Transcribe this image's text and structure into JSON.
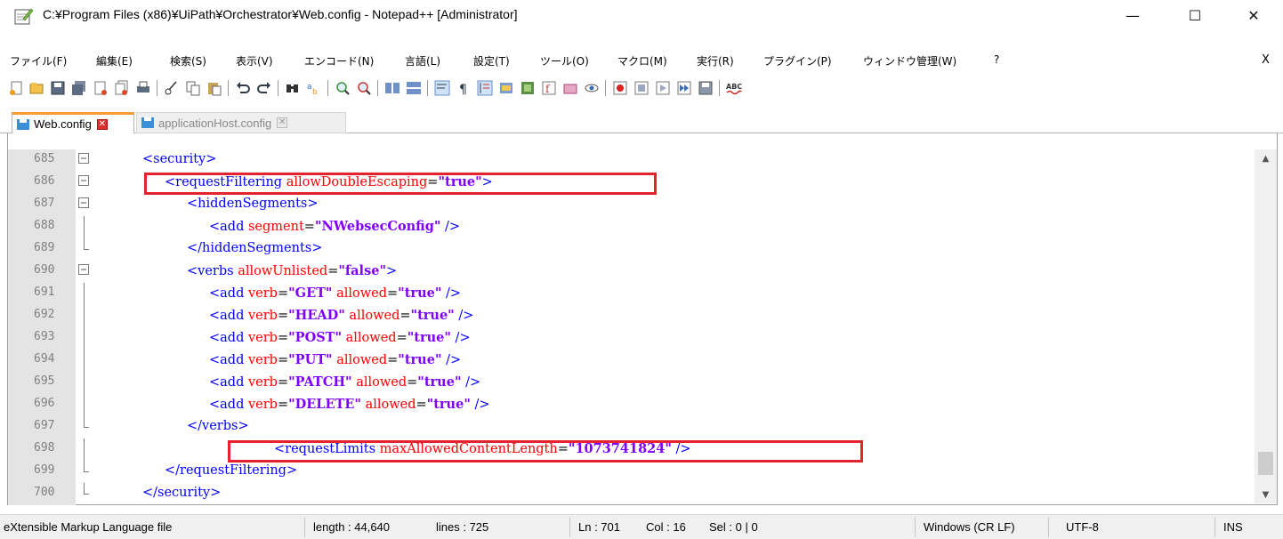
{
  "window": {
    "title": "C:¥Program Files (x86)¥UiPath¥Orchestrator¥Web.config - Notepad++ [Administrator]",
    "minimize_glyph": "—",
    "maximize_glyph": "☐",
    "close_glyph": "✕"
  },
  "menu": {
    "items": [
      "ファイル(F)",
      "編集(E)",
      "検索(S)",
      "表示(V)",
      "エンコード(N)",
      "言語(L)",
      "設定(T)",
      "ツール(O)",
      "マクロ(M)",
      "実行(R)",
      "プラグイン(P)",
      "ウィンドウ管理(W)",
      "?"
    ],
    "close_label": "X"
  },
  "tabs": [
    {
      "label": "Web.config",
      "active": true
    },
    {
      "label": "applicationHost.config",
      "active": false
    }
  ],
  "editor": {
    "lines": [
      {
        "num": "685",
        "parts": [
          [
            "tag",
            "<security>"
          ]
        ]
      },
      {
        "num": "686",
        "parts": [
          [
            "tag",
            "<requestFiltering "
          ],
          [
            "attr",
            "allowDoubleEscaping"
          ],
          [
            "eq",
            "="
          ],
          [
            "val",
            "\"true\""
          ],
          [
            "tag",
            ">"
          ]
        ]
      },
      {
        "num": "687",
        "parts": [
          [
            "tag",
            "<hiddenSegments>"
          ]
        ]
      },
      {
        "num": "688",
        "parts": [
          [
            "tag",
            "<add "
          ],
          [
            "attr",
            "segment"
          ],
          [
            "eq",
            "="
          ],
          [
            "val",
            "\"NWebsecConfig\""
          ],
          [
            "tag",
            " />"
          ]
        ]
      },
      {
        "num": "689",
        "parts": [
          [
            "tag",
            "</hiddenSegments>"
          ]
        ]
      },
      {
        "num": "690",
        "parts": [
          [
            "tag",
            "<verbs "
          ],
          [
            "attr",
            "allowUnlisted"
          ],
          [
            "eq",
            "="
          ],
          [
            "val",
            "\"false\""
          ],
          [
            "tag",
            ">"
          ]
        ]
      },
      {
        "num": "691",
        "parts": [
          [
            "tag",
            "<add "
          ],
          [
            "attr",
            "verb"
          ],
          [
            "eq",
            "="
          ],
          [
            "val",
            "\"GET\""
          ],
          [
            "tag",
            " "
          ],
          [
            "attr",
            "allowed"
          ],
          [
            "eq",
            "="
          ],
          [
            "val",
            "\"true\""
          ],
          [
            "tag",
            " />"
          ]
        ]
      },
      {
        "num": "692",
        "parts": [
          [
            "tag",
            "<add "
          ],
          [
            "attr",
            "verb"
          ],
          [
            "eq",
            "="
          ],
          [
            "val",
            "\"HEAD\""
          ],
          [
            "tag",
            " "
          ],
          [
            "attr",
            "allowed"
          ],
          [
            "eq",
            "="
          ],
          [
            "val",
            "\"true\""
          ],
          [
            "tag",
            " />"
          ]
        ]
      },
      {
        "num": "693",
        "parts": [
          [
            "tag",
            "<add "
          ],
          [
            "attr",
            "verb"
          ],
          [
            "eq",
            "="
          ],
          [
            "val",
            "\"POST\""
          ],
          [
            "tag",
            " "
          ],
          [
            "attr",
            "allowed"
          ],
          [
            "eq",
            "="
          ],
          [
            "val",
            "\"true\""
          ],
          [
            "tag",
            " />"
          ]
        ]
      },
      {
        "num": "694",
        "parts": [
          [
            "tag",
            "<add "
          ],
          [
            "attr",
            "verb"
          ],
          [
            "eq",
            "="
          ],
          [
            "val",
            "\"PUT\""
          ],
          [
            "tag",
            " "
          ],
          [
            "attr",
            "allowed"
          ],
          [
            "eq",
            "="
          ],
          [
            "val",
            "\"true\""
          ],
          [
            "tag",
            " />"
          ]
        ]
      },
      {
        "num": "695",
        "parts": [
          [
            "tag",
            "<add "
          ],
          [
            "attr",
            "verb"
          ],
          [
            "eq",
            "="
          ],
          [
            "val",
            "\"PATCH\""
          ],
          [
            "tag",
            " "
          ],
          [
            "attr",
            "allowed"
          ],
          [
            "eq",
            "="
          ],
          [
            "val",
            "\"true\""
          ],
          [
            "tag",
            " />"
          ]
        ]
      },
      {
        "num": "696",
        "parts": [
          [
            "tag",
            "<add "
          ],
          [
            "attr",
            "verb"
          ],
          [
            "eq",
            "="
          ],
          [
            "val",
            "\"DELETE\""
          ],
          [
            "tag",
            " "
          ],
          [
            "attr",
            "allowed"
          ],
          [
            "eq",
            "="
          ],
          [
            "val",
            "\"true\""
          ],
          [
            "tag",
            " />"
          ]
        ]
      },
      {
        "num": "697",
        "parts": [
          [
            "tag",
            "</verbs>"
          ]
        ]
      },
      {
        "num": "698",
        "parts": [
          [
            "tag",
            "<requestLimits "
          ],
          [
            "attr",
            "maxAllowedContentLength"
          ],
          [
            "eq",
            "="
          ],
          [
            "val",
            "\"1073741824\""
          ],
          [
            "tag",
            " />"
          ]
        ]
      },
      {
        "num": "699",
        "parts": [
          [
            "tag",
            "</requestFiltering>"
          ]
        ]
      },
      {
        "num": "700",
        "parts": [
          [
            "tag",
            "</security>"
          ]
        ]
      }
    ]
  },
  "status": {
    "file_type": "eXtensible Markup Language file",
    "length": "length : 44,640",
    "lines": "lines : 725",
    "ln": "Ln : 701",
    "col": "Col : 16",
    "sel": "Sel : 0 | 0",
    "eol": "Windows (CR LF)",
    "encoding": "UTF-8",
    "mode": "INS"
  },
  "colors": {
    "tag": "#0000ff",
    "attribute": "#ff0000",
    "value": "#8000ff",
    "highlight_box": "#e5232e",
    "active_tab_accent": "#fa9a32"
  }
}
